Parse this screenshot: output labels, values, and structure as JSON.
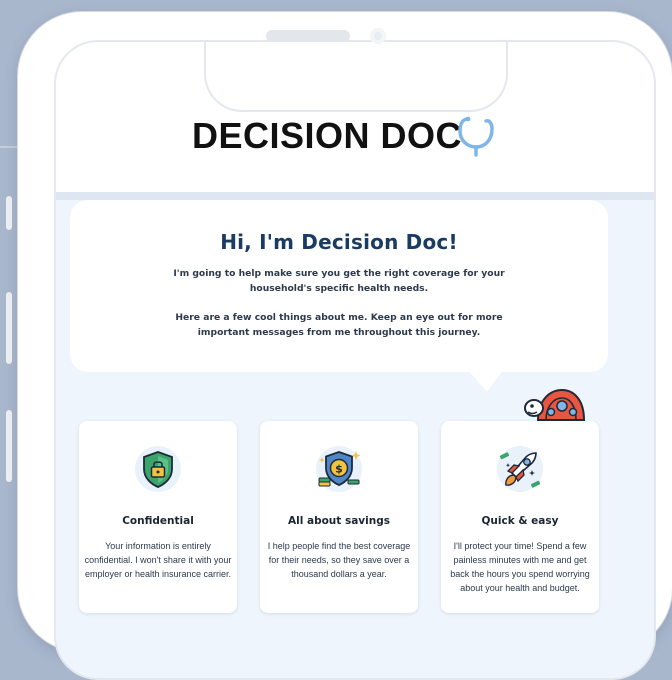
{
  "logo": {
    "text": "DECISION DOC",
    "icon": "stethoscope-icon"
  },
  "intro": {
    "heading": "Hi, I'm Decision Doc!",
    "paragraph1": "I'm going to help make sure you get the right coverage for your household's specific health needs.",
    "paragraph2": "Here are a few cool things about me. Keep an eye out for more important messages from me throughout this journey."
  },
  "mascot": {
    "icon": "turtle-icon"
  },
  "cards": [
    {
      "icon": "shield-lock-icon",
      "title": "Confidential",
      "body": "Your information is entirely confidential. I won't share it with your employer or health insurance carrier."
    },
    {
      "icon": "shield-dollar-icon",
      "title": "All about savings",
      "body": "I help people find the best coverage for their needs, so they save over a thousand dollars a year."
    },
    {
      "icon": "rocket-icon",
      "title": "Quick & easy",
      "body": "I'll protect your time! Spend a few painless minutes with me and get back the hours you spend worrying about your health and budget."
    }
  ],
  "colors": {
    "heading": "#1a3b63",
    "background": "#a9b7cd",
    "screen": "#eef5fc",
    "accent_blue": "#7fb6e6"
  }
}
